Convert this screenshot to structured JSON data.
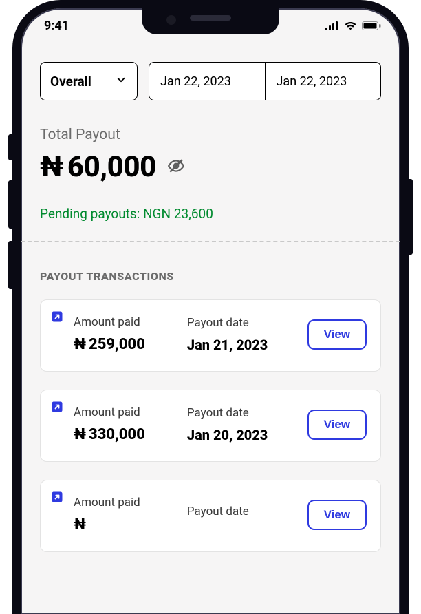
{
  "status": {
    "time": "9:41"
  },
  "filters": {
    "overall_label": "Overall",
    "date_from": "Jan 22, 2023",
    "date_to": "Jan 22, 2023"
  },
  "payout": {
    "label": "Total Payout",
    "currency_symbol": "₦",
    "amount": "60,000",
    "pending_text": "Pending payouts: NGN 23,600"
  },
  "transactions": {
    "section_title": "PAYOUT TRANSACTIONS",
    "amount_label": "Amount paid",
    "date_label": "Payout date",
    "view_label": "View",
    "items": [
      {
        "amount": "259,000",
        "date": "Jan 21, 2023"
      },
      {
        "amount": "330,000",
        "date": "Jan 20, 2023"
      },
      {
        "amount": "",
        "date": ""
      }
    ]
  },
  "colors": {
    "accent": "#2f3ae0",
    "success": "#008a2e"
  }
}
